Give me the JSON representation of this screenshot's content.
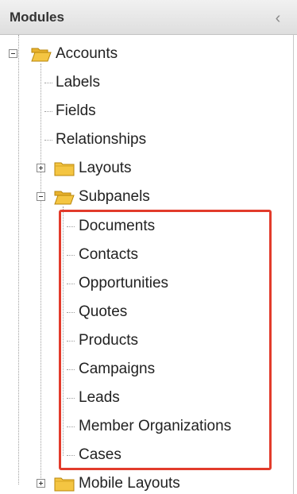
{
  "header": {
    "title": "Modules",
    "collapse_glyph": "‹"
  },
  "tree": {
    "root": {
      "label": "Accounts",
      "state": "expanded",
      "icon": "folder-open-icon"
    },
    "children": [
      {
        "label": "Labels"
      },
      {
        "label": "Fields"
      },
      {
        "label": "Relationships"
      },
      {
        "label": "Layouts",
        "state": "collapsed",
        "icon": "folder-icon"
      },
      {
        "label": "Subpanels",
        "state": "expanded",
        "icon": "folder-open-icon"
      }
    ],
    "subpanels": [
      {
        "label": "Documents"
      },
      {
        "label": "Contacts"
      },
      {
        "label": "Opportunities"
      },
      {
        "label": "Quotes"
      },
      {
        "label": "Products"
      },
      {
        "label": "Campaigns"
      },
      {
        "label": "Leads"
      },
      {
        "label": "Member Organizations"
      },
      {
        "label": "Cases"
      }
    ],
    "after": {
      "label": "Mobile Layouts",
      "state": "collapsed",
      "icon": "folder-icon"
    }
  },
  "colors": {
    "highlight": "#e23b2b",
    "folder_fill": "#f4c542",
    "folder_stroke": "#b8860b"
  }
}
